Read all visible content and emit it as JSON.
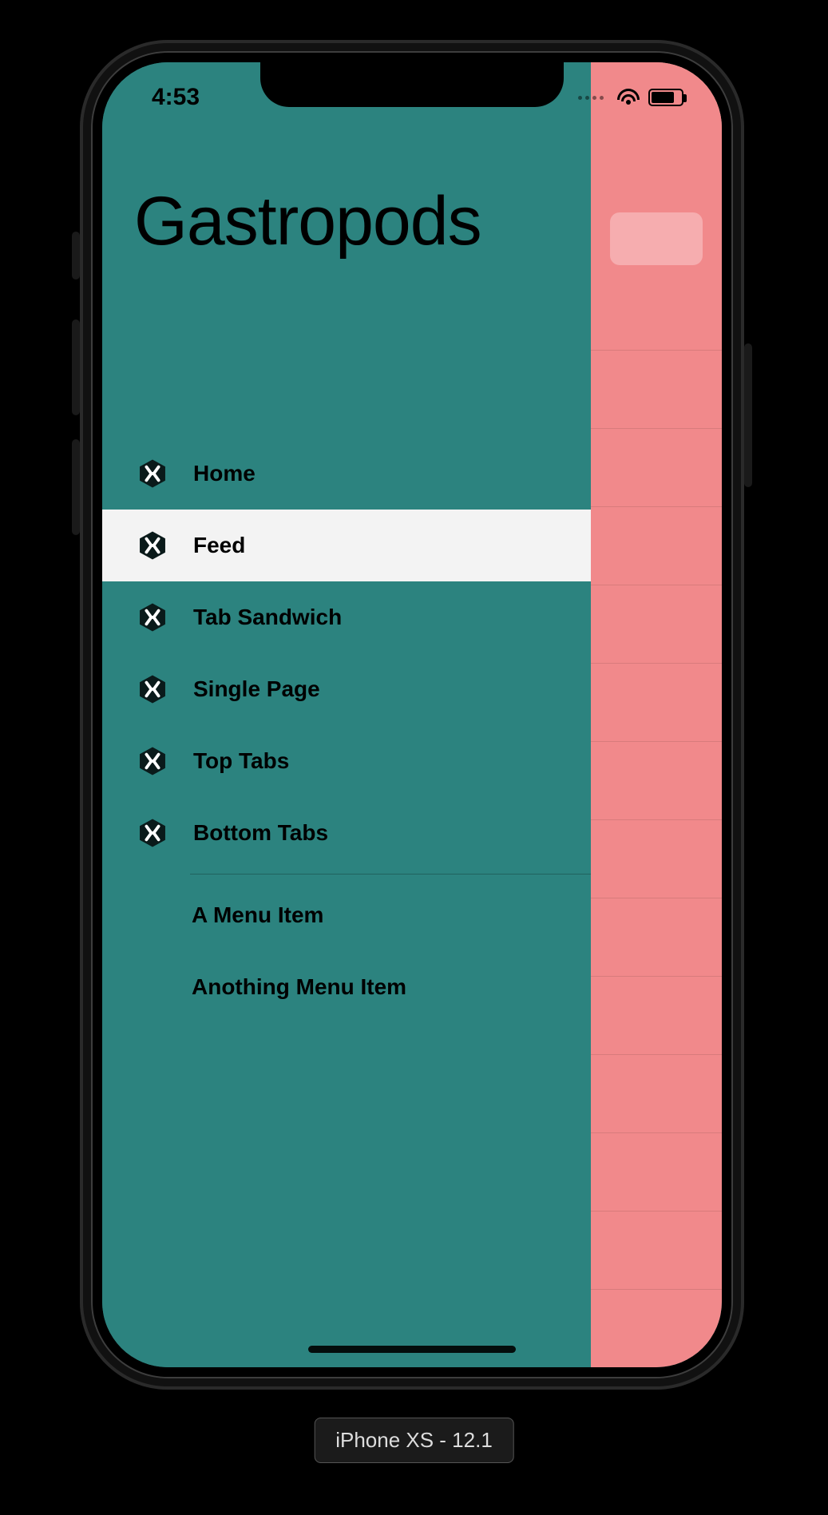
{
  "colors": {
    "drawer_bg": "#2c837f",
    "content_bg": "#f1898b",
    "badge_bg": "rgba(247,180,181,.85)",
    "selected_bg": "#f3f3f3",
    "text": "#000000"
  },
  "status": {
    "time": "4:53"
  },
  "drawer": {
    "title": "Gastropods",
    "sections": [
      {
        "items": [
          {
            "icon": "xamarin-icon",
            "label": "Home",
            "selected": false
          },
          {
            "icon": "xamarin-icon",
            "label": "Feed",
            "selected": true
          },
          {
            "icon": "xamarin-icon",
            "label": "Tab Sandwich",
            "selected": false
          },
          {
            "icon": "xamarin-icon",
            "label": "Single Page",
            "selected": false
          },
          {
            "icon": "xamarin-icon",
            "label": "Top Tabs",
            "selected": false
          },
          {
            "icon": "xamarin-icon",
            "label": "Bottom Tabs",
            "selected": false
          }
        ]
      },
      {
        "items": [
          {
            "icon": null,
            "label": "A Menu Item",
            "selected": false
          },
          {
            "icon": null,
            "label": "Anothing Menu Item",
            "selected": false
          }
        ]
      }
    ]
  },
  "background_list": {
    "row_count": 14
  },
  "device": {
    "label": "iPhone XS - 12.1"
  }
}
